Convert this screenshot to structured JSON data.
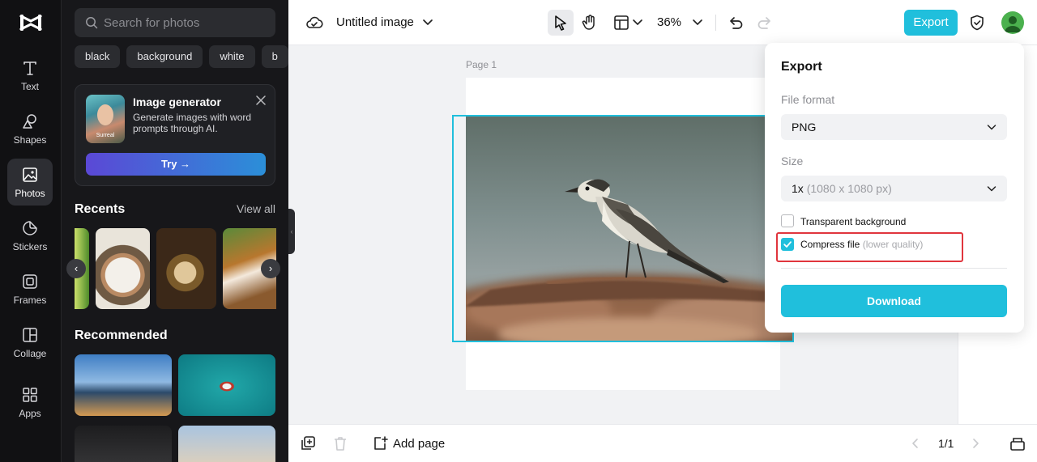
{
  "rail": {
    "items": [
      {
        "label": "Text",
        "icon": "text-icon"
      },
      {
        "label": "Shapes",
        "icon": "shapes-icon"
      },
      {
        "label": "Photos",
        "icon": "photos-icon",
        "active": true
      },
      {
        "label": "Stickers",
        "icon": "stickers-icon"
      },
      {
        "label": "Frames",
        "icon": "frames-icon"
      },
      {
        "label": "Collage",
        "icon": "collage-icon"
      },
      {
        "label": "Apps",
        "icon": "apps-icon"
      }
    ]
  },
  "panel": {
    "search_placeholder": "Search for photos",
    "chips": [
      "black",
      "background",
      "white",
      "b"
    ],
    "generator": {
      "title": "Image generator",
      "description": "Generate images with word prompts through AI.",
      "thumb_tag": "Surreal",
      "try_label": "Try →"
    },
    "recents_title": "Recents",
    "view_all": "View all",
    "recommended_title": "Recommended"
  },
  "topbar": {
    "doc_title": "Untitled image",
    "zoom": "36%",
    "export_label": "Export"
  },
  "canvas": {
    "page_label": "Page 1"
  },
  "bottombar": {
    "add_page": "Add page",
    "pager": "1/1"
  },
  "export_popover": {
    "title": "Export",
    "file_format_label": "File format",
    "file_format_value": "PNG",
    "size_label": "Size",
    "size_value": "1x",
    "size_hint": "(1080 x 1080 px)",
    "transparent_label": "Transparent background",
    "transparent_checked": false,
    "compress_label": "Compress file",
    "compress_hint": "(lower quality)",
    "compress_checked": true,
    "download_label": "Download"
  },
  "colors": {
    "accent": "#20bfdc",
    "highlight": "#e0353d",
    "rail_bg": "#111113",
    "panel_bg": "#17171a"
  }
}
